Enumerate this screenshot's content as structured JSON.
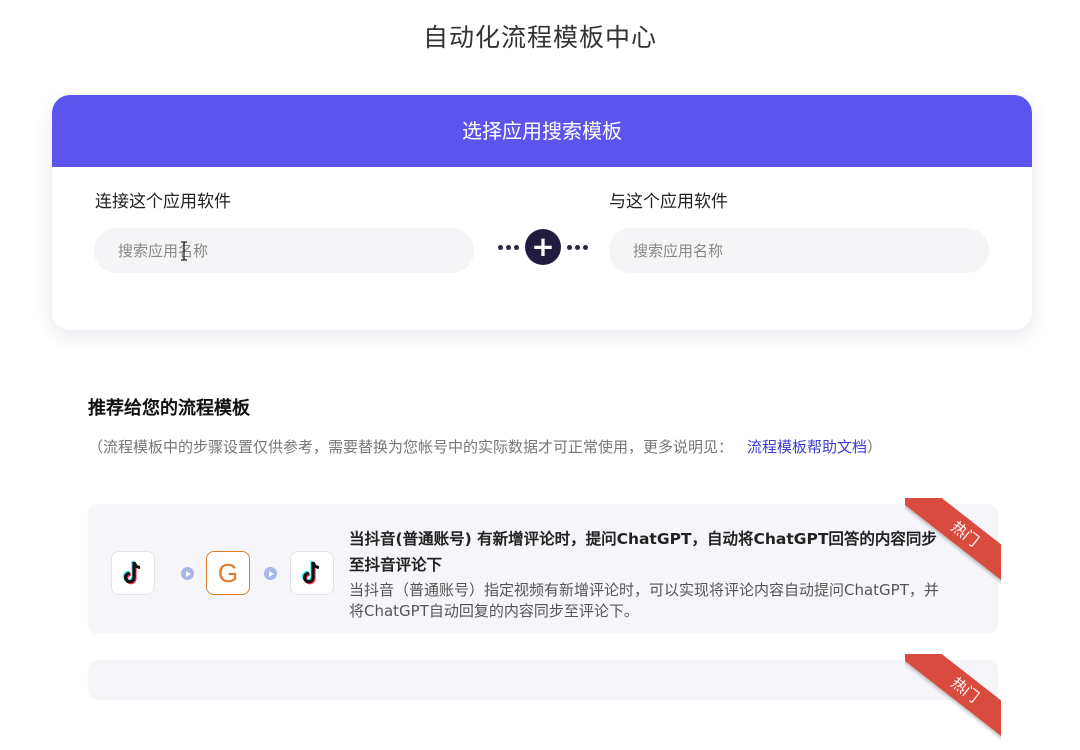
{
  "page": {
    "title": "自动化流程模板中心"
  },
  "search": {
    "header": "选择应用搜索模板",
    "left_label": "连接这个应用软件",
    "right_label": "与这个应用软件",
    "left_placeholder": "搜索应用名称",
    "right_placeholder": "搜索应用名称",
    "connector_symbol": "+"
  },
  "recommended": {
    "title": "推荐给您的流程模板",
    "note_prefix": "（流程模板中的步骤设置仅供参考，需要替换为您帐号中的实际数据才可正常使用，更多说明见：",
    "note_link": "流程模板帮助文档",
    "note_suffix": "）",
    "templates": [
      {
        "badge": "热门",
        "apps": [
          "tiktok-icon",
          "chatgpt-icon",
          "tiktok-icon"
        ],
        "gpt_letter": "G",
        "title": "当抖音(普通账号) 有新增评论时，提问ChatGPT，自动将ChatGPT回答的内容同步至抖音评论下",
        "description": "当抖音（普通账号）指定视频有新增评论时，可以实现将评论内容自动提问ChatGPT，并将ChatGPT自动回复的内容同步至评论下。"
      },
      {
        "badge": "热门"
      }
    ]
  },
  "colors": {
    "accent": "#5B55EE",
    "ribbon": "#d94b3e",
    "link": "#3a3fd0",
    "gpt_orange": "#e07d2c"
  }
}
